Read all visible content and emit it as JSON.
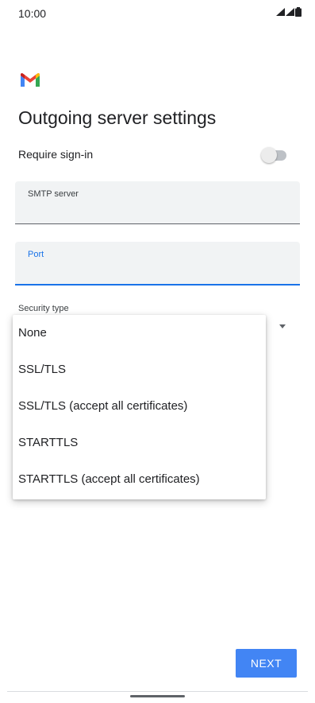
{
  "status_bar": {
    "time": "10:00",
    "icons": [
      "signal-icon",
      "signal-icon",
      "battery-icon"
    ]
  },
  "app": {
    "logo": "gmail-logo"
  },
  "page": {
    "title": "Outgoing server settings"
  },
  "require_signin": {
    "label": "Require sign-in",
    "enabled": false
  },
  "fields": {
    "smtp": {
      "label": "SMTP server",
      "value": ""
    },
    "port": {
      "label": "Port",
      "value": "",
      "focused": true
    }
  },
  "security": {
    "label": "Security type",
    "options": [
      "None",
      "SSL/TLS",
      "SSL/TLS (accept all certificates)",
      "STARTTLS",
      "STARTTLS (accept all certificates)"
    ]
  },
  "footer": {
    "next_label": "NEXT"
  },
  "colors": {
    "accent": "#1a73e8",
    "button": "#4285f4"
  }
}
